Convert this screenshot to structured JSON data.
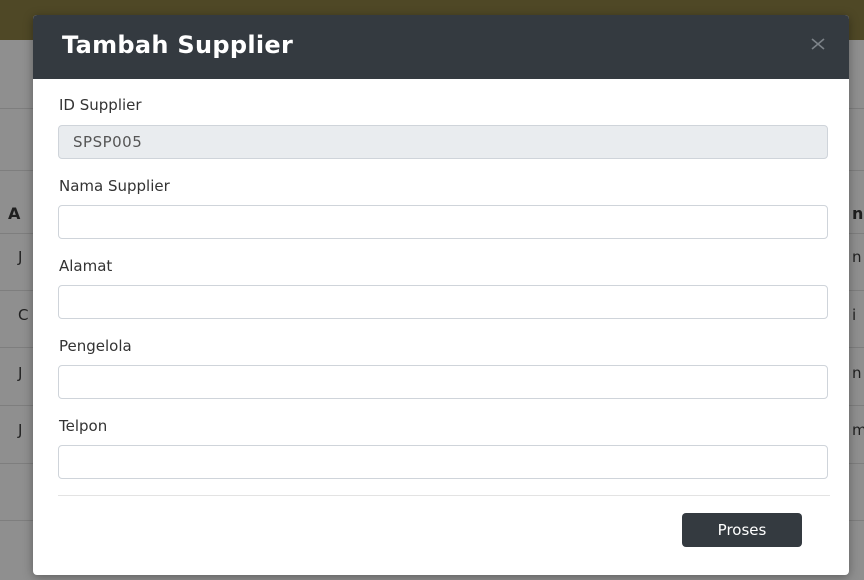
{
  "background": {
    "table_header_initial": "A",
    "table_header_right": "n",
    "left_cells": [
      "J",
      "C",
      "J",
      "J"
    ],
    "right_cells": [
      "n",
      "i",
      "n",
      "m"
    ]
  },
  "modal": {
    "title": "Tambah Supplier",
    "close_icon": "close-icon",
    "fields": {
      "id_supplier": {
        "label": "ID Supplier",
        "value": "SPSP005"
      },
      "nama_supplier": {
        "label": "Nama Supplier",
        "value": ""
      },
      "alamat": {
        "label": "Alamat",
        "value": ""
      },
      "pengelola": {
        "label": "Pengelola",
        "value": ""
      },
      "telpon": {
        "label": "Telpon",
        "value": ""
      }
    },
    "submit_label": "Proses"
  },
  "colors": {
    "header_bg": "#343a40",
    "button_bg": "#343a40",
    "topbar": "#4f4826"
  }
}
